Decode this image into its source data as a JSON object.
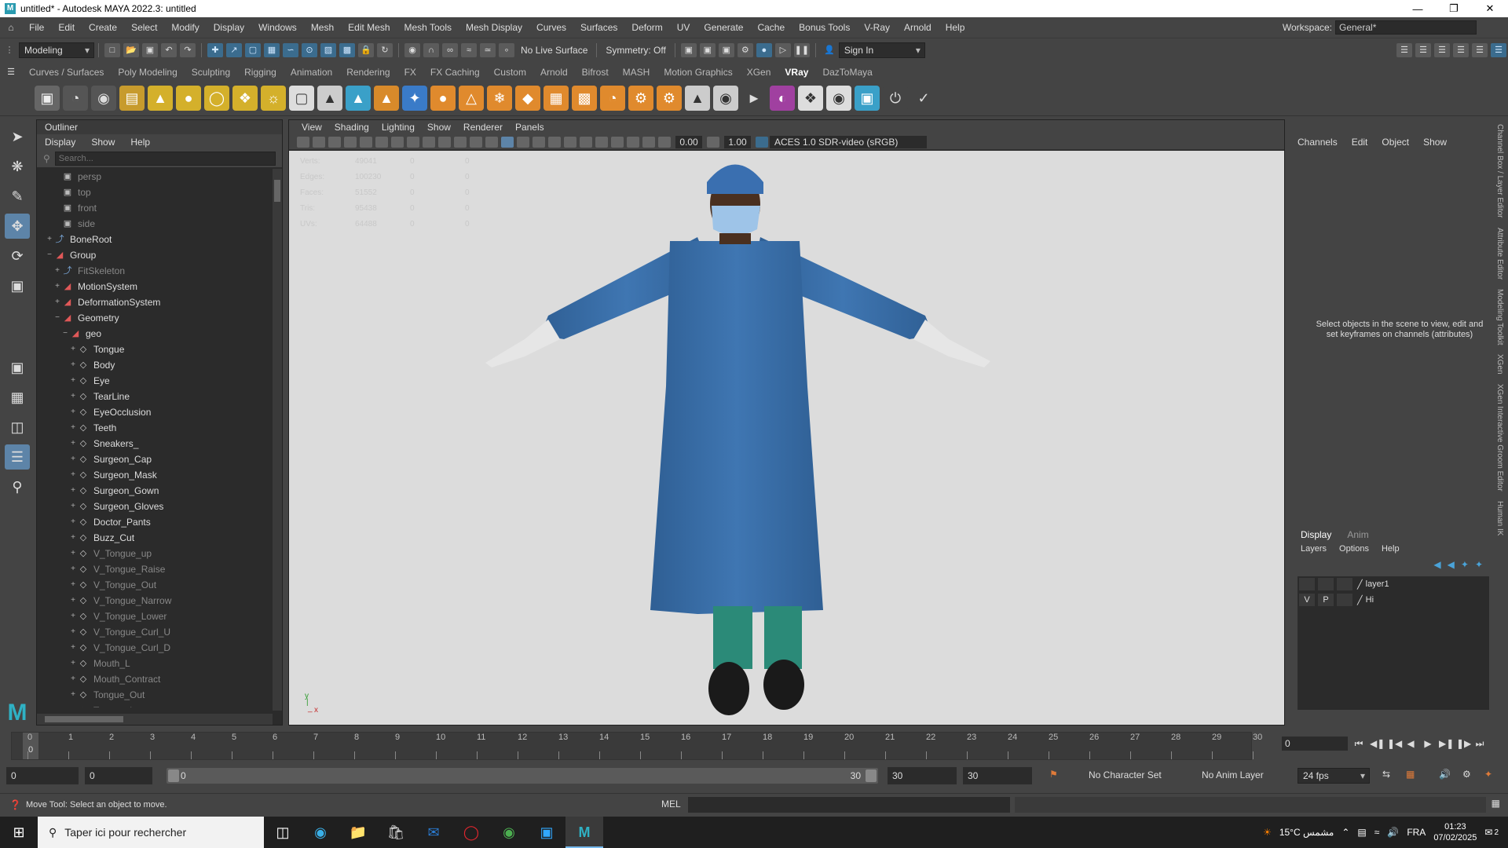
{
  "window": {
    "title": "untitled* - Autodesk MAYA 2022.3: untitled",
    "logo": "M"
  },
  "menu": {
    "items": [
      "File",
      "Edit",
      "Create",
      "Select",
      "Modify",
      "Display",
      "Windows",
      "Mesh",
      "Edit Mesh",
      "Mesh Tools",
      "Mesh Display",
      "Curves",
      "Surfaces",
      "Deform",
      "UV",
      "Generate",
      "Cache",
      "Bonus Tools",
      "V-Ray",
      "Arnold",
      "Help"
    ],
    "workspace_label": "Workspace:",
    "workspace_value": "General*"
  },
  "toolbar": {
    "mode": "Modeling",
    "live_surface": "No Live Surface",
    "symmetry": "Symmetry: Off",
    "sign_in": "Sign In"
  },
  "shelf": {
    "tabs": [
      "Curves / Surfaces",
      "Poly Modeling",
      "Sculpting",
      "Rigging",
      "Animation",
      "Rendering",
      "FX",
      "FX Caching",
      "Custom",
      "Arnold",
      "Bifrost",
      "MASH",
      "Motion Graphics",
      "XGen",
      "VRay",
      "DazToMaya"
    ],
    "active_tab": "VRay"
  },
  "outliner": {
    "title": "Outliner",
    "menu": [
      "Display",
      "Show",
      "Help"
    ],
    "search_placeholder": "Search...",
    "items": [
      {
        "label": "persp",
        "level": 1,
        "icon": "camera",
        "dim": true,
        "exp": ""
      },
      {
        "label": "top",
        "level": 1,
        "icon": "camera",
        "dim": true,
        "exp": ""
      },
      {
        "label": "front",
        "level": 1,
        "icon": "camera",
        "dim": true,
        "exp": ""
      },
      {
        "label": "side",
        "level": 1,
        "icon": "camera",
        "dim": true,
        "exp": ""
      },
      {
        "label": "BoneRoot",
        "level": 0,
        "icon": "joint",
        "dim": false,
        "exp": "+"
      },
      {
        "label": "Group",
        "level": 0,
        "icon": "group",
        "dim": false,
        "exp": "−"
      },
      {
        "label": "FitSkeleton",
        "level": 1,
        "icon": "joint",
        "dim": true,
        "exp": "+"
      },
      {
        "label": "MotionSystem",
        "level": 1,
        "icon": "group",
        "dim": false,
        "exp": "+"
      },
      {
        "label": "DeformationSystem",
        "level": 1,
        "icon": "group",
        "dim": false,
        "exp": "+"
      },
      {
        "label": "Geometry",
        "level": 1,
        "icon": "group",
        "dim": false,
        "exp": "−"
      },
      {
        "label": "geo",
        "level": 2,
        "icon": "group",
        "dim": false,
        "exp": "−"
      },
      {
        "label": "Tongue",
        "level": 3,
        "icon": "mesh",
        "dim": false,
        "exp": "+"
      },
      {
        "label": "Body",
        "level": 3,
        "icon": "mesh",
        "dim": false,
        "exp": "+"
      },
      {
        "label": "Eye",
        "level": 3,
        "icon": "mesh",
        "dim": false,
        "exp": "+"
      },
      {
        "label": "TearLine",
        "level": 3,
        "icon": "mesh",
        "dim": false,
        "exp": "+"
      },
      {
        "label": "EyeOcclusion",
        "level": 3,
        "icon": "mesh",
        "dim": false,
        "exp": "+"
      },
      {
        "label": "Teeth",
        "level": 3,
        "icon": "mesh",
        "dim": false,
        "exp": "+"
      },
      {
        "label": "Sneakers_",
        "level": 3,
        "icon": "mesh",
        "dim": false,
        "exp": "+"
      },
      {
        "label": "Surgeon_Cap",
        "level": 3,
        "icon": "mesh",
        "dim": false,
        "exp": "+"
      },
      {
        "label": "Surgeon_Mask",
        "level": 3,
        "icon": "mesh",
        "dim": false,
        "exp": "+"
      },
      {
        "label": "Surgeon_Gown",
        "level": 3,
        "icon": "mesh",
        "dim": false,
        "exp": "+"
      },
      {
        "label": "Surgeon_Gloves",
        "level": 3,
        "icon": "mesh",
        "dim": false,
        "exp": "+"
      },
      {
        "label": "Doctor_Pants",
        "level": 3,
        "icon": "mesh",
        "dim": false,
        "exp": "+"
      },
      {
        "label": "Buzz_Cut",
        "level": 3,
        "icon": "mesh",
        "dim": false,
        "exp": "+"
      },
      {
        "label": "V_Tongue_up",
        "level": 3,
        "icon": "mesh",
        "dim": true,
        "exp": "+"
      },
      {
        "label": "V_Tongue_Raise",
        "level": 3,
        "icon": "mesh",
        "dim": true,
        "exp": "+"
      },
      {
        "label": "V_Tongue_Out",
        "level": 3,
        "icon": "mesh",
        "dim": true,
        "exp": "+"
      },
      {
        "label": "V_Tongue_Narrow",
        "level": 3,
        "icon": "mesh",
        "dim": true,
        "exp": "+"
      },
      {
        "label": "V_Tongue_Lower",
        "level": 3,
        "icon": "mesh",
        "dim": true,
        "exp": "+"
      },
      {
        "label": "V_Tongue_Curl_U",
        "level": 3,
        "icon": "mesh",
        "dim": true,
        "exp": "+"
      },
      {
        "label": "V_Tongue_Curl_D",
        "level": 3,
        "icon": "mesh",
        "dim": true,
        "exp": "+"
      },
      {
        "label": "Mouth_L",
        "level": 3,
        "icon": "mesh",
        "dim": true,
        "exp": "+"
      },
      {
        "label": "Mouth_Contract",
        "level": 3,
        "icon": "mesh",
        "dim": true,
        "exp": "+"
      },
      {
        "label": "Tongue_Out",
        "level": 3,
        "icon": "mesh",
        "dim": true,
        "exp": "+"
      },
      {
        "label": "Tongue_In",
        "level": 3,
        "icon": "mesh",
        "dim": true,
        "exp": "+"
      }
    ]
  },
  "viewport": {
    "menu": [
      "View",
      "Shading",
      "Lighting",
      "Show",
      "Renderer",
      "Panels"
    ],
    "exposure": "0.00",
    "gamma": "1.00",
    "color_space": "ACES 1.0 SDR-video (sRGB)",
    "hud": [
      [
        "Verts:",
        "49041",
        "0",
        "0"
      ],
      [
        "Edges:",
        "100230",
        "0",
        "0"
      ],
      [
        "Faces:",
        "51552",
        "0",
        "0"
      ],
      [
        "Tris:",
        "95438",
        "0",
        "0"
      ],
      [
        "UVs:",
        "64488",
        "0",
        "0"
      ]
    ]
  },
  "channelbox": {
    "menu": [
      "Channels",
      "Edit",
      "Object",
      "Show"
    ],
    "message": "Select objects in the scene to view, edit and set keyframes on channels (attributes)"
  },
  "layers": {
    "tabs": [
      "Display",
      "Anim"
    ],
    "menu": [
      "Layers",
      "Options",
      "Help"
    ],
    "rows": [
      {
        "v": "",
        "p": "",
        "name": "layer1"
      },
      {
        "v": "V",
        "p": "P",
        "name": "Hi"
      }
    ]
  },
  "rightstrip": [
    "Channel Box / Layer Editor",
    "Attribute Editor",
    "Modeling Toolkit",
    "XGen",
    "XGen Interactive Groom Editor",
    "Human IK"
  ],
  "timeline": {
    "ticks": [
      "0",
      "1",
      "2",
      "3",
      "4",
      "5",
      "6",
      "7",
      "8",
      "9",
      "10",
      "11",
      "12",
      "13",
      "14",
      "15",
      "16",
      "17",
      "18",
      "19",
      "20",
      "21",
      "22",
      "23",
      "24",
      "25",
      "26",
      "27",
      "28",
      "29",
      "30"
    ],
    "current_frame": "0",
    "current_field": "0"
  },
  "range": {
    "start": "0",
    "anim_start": "0",
    "slider_start": "0",
    "slider_end": "30",
    "anim_end": "30",
    "end": "30",
    "character_set": "No Character Set",
    "anim_layer": "No Anim Layer",
    "fps": "24 fps"
  },
  "status": {
    "help": "Move Tool: Select an object to move.",
    "mel": "MEL"
  },
  "taskbar": {
    "search": "Taper ici pour rechercher",
    "weather": "15°C  مشمس",
    "lang": "FRA",
    "time": "01:23",
    "date": "07/02/2025",
    "notif": "2"
  }
}
